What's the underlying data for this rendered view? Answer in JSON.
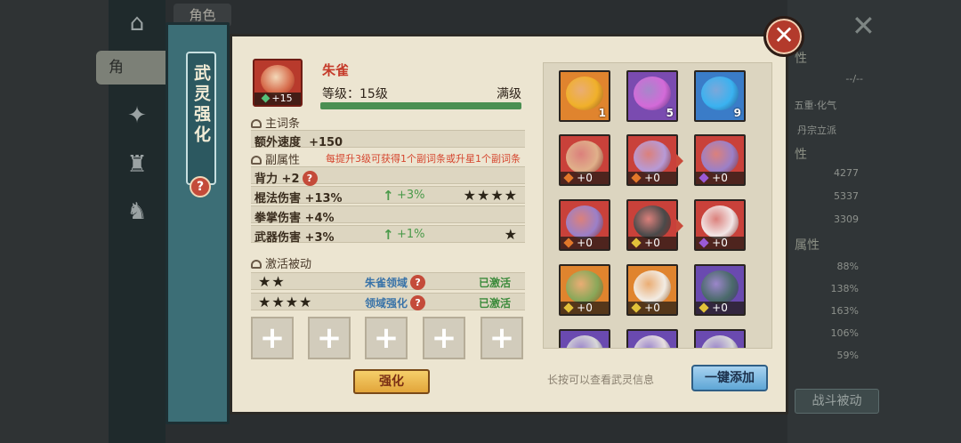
{
  "background": {
    "top_tab": "角色",
    "side_tab": "角",
    "stats": [
      "4277",
      "5337",
      "3309",
      "88%",
      "138%",
      "163%",
      "106%",
      "59%"
    ],
    "labels": [
      "性",
      "性",
      "属性"
    ],
    "right_texts": [
      "五重·化气",
      "丹宗立派",
      "--/--"
    ],
    "battle_passive": "战斗被动"
  },
  "side": {
    "title": "武灵强化",
    "help": "?"
  },
  "close": "✕",
  "spirit": {
    "name": "朱雀",
    "portrait_level": "+15",
    "level_text": "等级：15级",
    "level_status": "满级",
    "level_progress": 1.0
  },
  "main_attr": {
    "header": "主词条",
    "label": "额外速度",
    "value": "+150"
  },
  "sub_attr": {
    "header": "副属性",
    "note": "每提升3级可获得1个副词条或升星1个副词条",
    "rows": [
      {
        "label": "背力",
        "value": "+2",
        "help": "?",
        "up": "",
        "stars": ""
      },
      {
        "label": "棍法伤害",
        "value": "+13%",
        "help": "",
        "up": "+3%",
        "stars": "★★★★"
      },
      {
        "label": "拳掌伤害",
        "value": "+4%",
        "help": "",
        "up": "",
        "stars": ""
      },
      {
        "label": "武器伤害",
        "value": "+3%",
        "help": "",
        "up": "+1%",
        "stars": "★"
      }
    ]
  },
  "passive": {
    "header": "激活被动",
    "rows": [
      {
        "stars": "★★",
        "name": "朱雀领域",
        "help": "?",
        "status": "已激活"
      },
      {
        "stars": "★★★★",
        "name": "领域强化",
        "help": "?",
        "status": "已激活"
      }
    ]
  },
  "slots": [
    "+",
    "+",
    "+",
    "+",
    "+"
  ],
  "strengthen_button": "强化",
  "hint": "长按可以查看武灵信息",
  "auto_add_button": "一键添加",
  "grid": {
    "top_row": [
      {
        "name": "fire-orb",
        "count": "1",
        "bg": "#e0842e",
        "art": "#f0b02a"
      },
      {
        "name": "purple-orb",
        "count": "5",
        "bg": "#7a4bb0",
        "art": "#d36ad8"
      },
      {
        "name": "blue-orb",
        "count": "9",
        "bg": "#3a7cc8",
        "art": "#3ab2f0"
      }
    ],
    "spirit_rows": [
      [
        {
          "name": "red-beast",
          "level": "+0",
          "bg": "#c9413a",
          "art": "#e0b08a",
          "gem": "#e2782a"
        },
        {
          "name": "purple-pig",
          "level": "+0",
          "bg": "#c9413a",
          "art": "#b79ad6",
          "gem": "#e2782a",
          "arrow": true
        },
        {
          "name": "purple-wolf",
          "level": "+0",
          "bg": "#c9413a",
          "art": "#9b80c8",
          "gem": "#9a5ad6"
        }
      ],
      [
        {
          "name": "purple-tiger",
          "level": "+0",
          "bg": "#c9413a",
          "art": "#9b80c8",
          "gem": "#e2782a"
        },
        {
          "name": "black-dragon",
          "level": "+0",
          "bg": "#c9413a",
          "art": "#4a4a4a",
          "gem": "#e2c23a",
          "arrow": true
        },
        {
          "name": "white-fox",
          "level": "+0",
          "bg": "#c9413a",
          "art": "#f2e6e6",
          "gem": "#9a5ad6"
        }
      ],
      [
        {
          "name": "turtle",
          "level": "+0",
          "bg": "#e0842e",
          "art": "#8aa85a",
          "gem": "#e2c23a"
        },
        {
          "name": "white-deer",
          "level": "+0",
          "bg": "#e0842e",
          "art": "#f2ece4",
          "gem": "#e2c23a"
        },
        {
          "name": "dark-dragon",
          "level": "+0",
          "bg": "#6a4ab0",
          "art": "#4a6a6a",
          "gem": "#e2c23a"
        }
      ],
      [
        {
          "name": "partial-1",
          "level": "",
          "bg": "#6a4ab0",
          "art": "#d8d8d8",
          "gem": ""
        },
        {
          "name": "partial-2",
          "level": "",
          "bg": "#6a4ab0",
          "art": "#e8e0e0",
          "gem": ""
        },
        {
          "name": "partial-3",
          "level": "",
          "bg": "#6a4ab0",
          "art": "#d8d8d8",
          "gem": ""
        }
      ]
    ]
  }
}
